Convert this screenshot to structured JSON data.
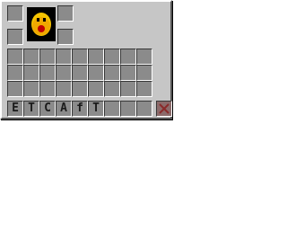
{
  "inventory": {
    "top_left_slots": [
      "",
      "",
      ""
    ],
    "top_right_slots": [
      "",
      "",
      ""
    ],
    "main_rows": 3,
    "main_cols": 9,
    "hotbar_items": [
      "E",
      "T",
      "C",
      "A",
      "f",
      "T",
      "",
      "",
      ""
    ],
    "delete_icon": "close-icon"
  },
  "colors": {
    "panel": "#c6c6c6",
    "slot": "#8b8b8b",
    "face_bg": "#000000",
    "face_yellow": "#f5c400",
    "face_orange": "#f08a00",
    "delete_x": "#8a2a2a"
  }
}
